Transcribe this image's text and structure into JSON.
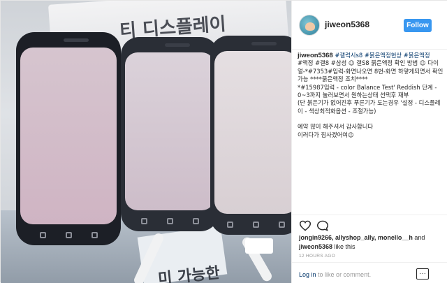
{
  "post": {
    "username": "jiweon5368",
    "follow_label": "Follow"
  },
  "photo": {
    "sign_text": "티 디스플레이",
    "box_text": "미 가능한"
  },
  "caption": {
    "lines": [
      {
        "user": "jiweon5368",
        "rest": "#갤럭시s8 #붉은액정현상 #붉은액정"
      },
      {
        "text": "#액정 #갤8 #삼성 ☺ 갤S8 붉은액정 확인 방법 ☺ 다이얼-*#7353#입력-화면나오면 8번-화면 하얗게되면서 확인가능 ****붉은액정 조치****"
      },
      {
        "text": "*#15987입력 - color Balance Test' Reddish 단계 - 0~3까지 눌러보면서 원하는상태 선택후 재부"
      },
      {
        "text": "(단 붉은기가 없어진후 푸른기가 도는경우 '설정 - 디스플레이 - 색상최적화옵션 - 조절가능)"
      },
      {
        "text": ""
      },
      {
        "text": "예약 많이 해주셔서 감사합니다"
      },
      {
        "text": "이러다가 집사겠어여☺"
      }
    ]
  },
  "likes": {
    "users": "jongin9266, allyshop_ally, monello__h",
    "and_label": "and",
    "last_user": "jiweon5368",
    "suffix": "like this"
  },
  "timestamp": "12 HOURS AGO",
  "footer": {
    "login_link": "Log in",
    "rest": "to like or comment.",
    "more_label": "···"
  },
  "icons": {
    "heart": "heart-icon",
    "comment": "comment-icon",
    "more": "more-options-icon"
  },
  "colors": {
    "follow_button": "#3897f0",
    "link": "#003569",
    "muted": "#999999",
    "screen_tint": "#d9c3cf"
  }
}
